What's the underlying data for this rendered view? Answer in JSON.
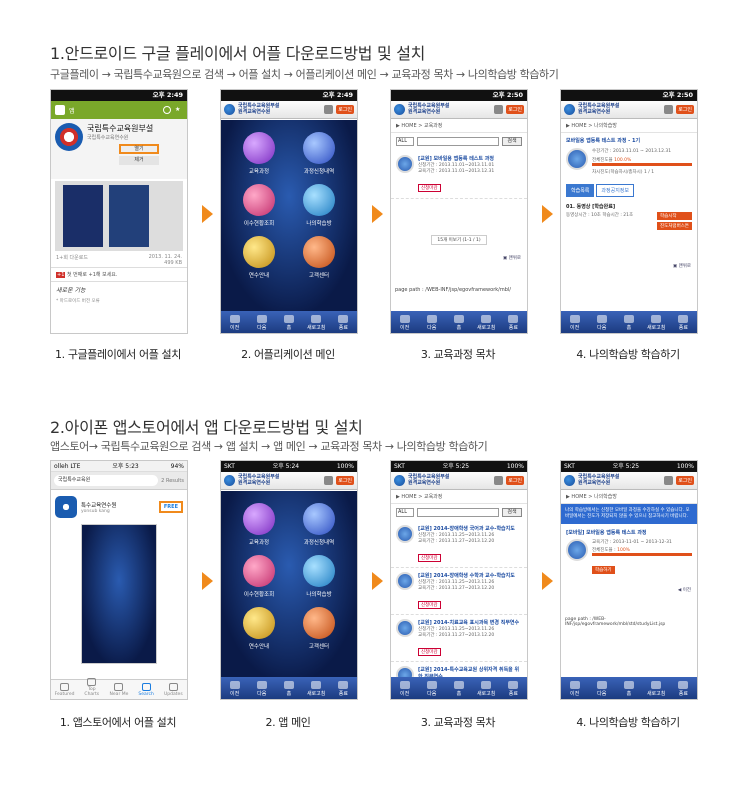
{
  "section1": {
    "title": "1.안드로이드 구글 플레이에서 어플 다운로드방법 및 설치",
    "subtitle": "구글플레이 → 국립특수교육원으로 검색 → 어플 설치 → 어플리케이션 메인 → 교육과정 목차 → 나의학습방 학습하기",
    "captions": [
      "1. 구글플레이에서 어플 설치",
      "2. 어플리케이션 메인",
      "3. 교육과정 목차",
      "4. 나의학습방 학습하기"
    ]
  },
  "section2": {
    "title": "2.아이폰 앱스토어에서 앱 다운로드방법 및 설치",
    "subtitle": "앱스토어→ 국립특수교육원으로 검색 → 앱 설치 → 앱 메인 → 교육과정 목차 → 나의학습방 학습하기",
    "captions": [
      "1. 앱스토어에서 어플 설치",
      "2. 앱 메인",
      "3. 교육과정 목차",
      "4. 나의학습방 학습하기"
    ]
  },
  "android": {
    "time1": "오후 2:49",
    "time2": "오후 2:50",
    "playstore": {
      "bar_label": "앱",
      "app_name": "국립특수교육원부설",
      "app_sub": "국립특수교육연수원",
      "open_btn": "열기",
      "remove_btn": "제거",
      "date": "2013. 11. 24.",
      "size": "499 KB",
      "downloads": "1+회 다운로드",
      "rate_text": "첫 번째로 +1해 보세요.",
      "new_label": "새로운 기능",
      "new_item": "* 마드로이드 버전 오류"
    },
    "course_item": {
      "title": "[교원] 모바일용 앱등록 테스트 과정",
      "line1": "신청기간 : 2013.11.01~2013.11.01",
      "line2": "교육기간 : 2013.11.01~2013.12.31",
      "apply_btn": "신청마감"
    },
    "pager": "15개 이보기 (1-1 / 1)",
    "footer_path": "page path : /WEB-INF/jsp/egovframework/mbl/",
    "my": {
      "course_title": "모바일용 앱등록 테스트 과정 - 1기",
      "period_label": "수강기간 :",
      "period": "2013.11.01 ~ 2013.12.31",
      "progress_label": "전체진도율",
      "progress_text": "100.0%",
      "progress": 1.0,
      "seq_label": "차시진도(학습차시/총차시)",
      "seq_value": "1 / 1",
      "tab1": "학습목록",
      "tab2": "과정공지정보",
      "lesson": "01. 동영상 [학습완료]",
      "lesson_meta": "동영상시간 : 10초  학습시간 : 21초",
      "btn1": "학습시작",
      "btn2": "진도처럼버스튼"
    }
  },
  "ios": {
    "carrier": "olleh  LTE",
    "carrier2": "SKT",
    "time1": "오후 5:23",
    "time2": "오후 5:24",
    "time3": "오후 5:25",
    "battery": "94%",
    "battery2": "100%",
    "appstore": {
      "search": "국립특수교육원",
      "results": "2 Results",
      "app_name": "특수교육연수원",
      "dev": "yonsub kang",
      "free_btn": "FREE",
      "tabs": [
        "Featured",
        "Top Charts",
        "Near Me",
        "Search",
        "Updates"
      ]
    },
    "courses": [
      {
        "title": "[교원] 2014-장애학생 국어과 교수-학습지도",
        "l1": "신청기간 : 2013.11.25~2013.11.26",
        "l2": "교육기간 : 2013.11.27~2013.12.20"
      },
      {
        "title": "[교원] 2014-장애학생 수학과 교수-학습지도",
        "l1": "신청기간 : 2013.11.25~2013.11.26",
        "l2": "교육기간 : 2013.11.27~2013.12.20"
      },
      {
        "title": "[교원] 2014-치료교육 표시과목 변경 직무연수",
        "l1": "신청기간 : 2013.11.25~2013.11.26",
        "l2": "교육기간 : 2013.11.27~2013.12.20"
      },
      {
        "title": "[교원] 2014-특수교육교원 상위자격 취득을 위한 직무연수",
        "l1": "신청기간 : 2013.11.25~2013.11.26",
        "l2": ""
      }
    ],
    "apply_btn": "신청마감",
    "my": {
      "notice": "나의 학습방에서는 신청한 모바일 과정을 수강하실 수 있습니다. 모바일에서는 진도가 저장되지 않을 수 있으니 참고하시기 바랍니다.",
      "course_title": "[모바일] 모바일용 앱등록 테스트 과정",
      "period_label": "교육기간 :",
      "period": "2013-11-01 ~ 2013-12-31",
      "progress_label": "전체진도율 :",
      "progress_text": "100%",
      "progress": 1.0,
      "btn": "학습하기",
      "prev": "◀ 이전",
      "footer_path": "page path : /WEB-INF/jsp/egovframework/mbl/std/studyList.jsp"
    }
  },
  "app": {
    "header_line1": "국립특수교육원부설",
    "header_line2": "원격교육연수원",
    "login": "로그인",
    "home_crumb": "▶ HOME > 교육과정",
    "my_crumb": "▶ HOME > 나의학습방",
    "all": "ALL",
    "search_btn": "검색",
    "menu": [
      "교육과정",
      "과정신청내역",
      "이수현황조회",
      "나의학습방",
      "연수안내",
      "고객센터"
    ],
    "nav": [
      "이전",
      "다음",
      "홈",
      "새로고침",
      "종료"
    ],
    "to_top": "▣ 맨위로"
  },
  "colors": {
    "accent_orange": "#f08a1c",
    "brand_blue": "#1a3e8a",
    "play_green": "#7aa82a"
  }
}
